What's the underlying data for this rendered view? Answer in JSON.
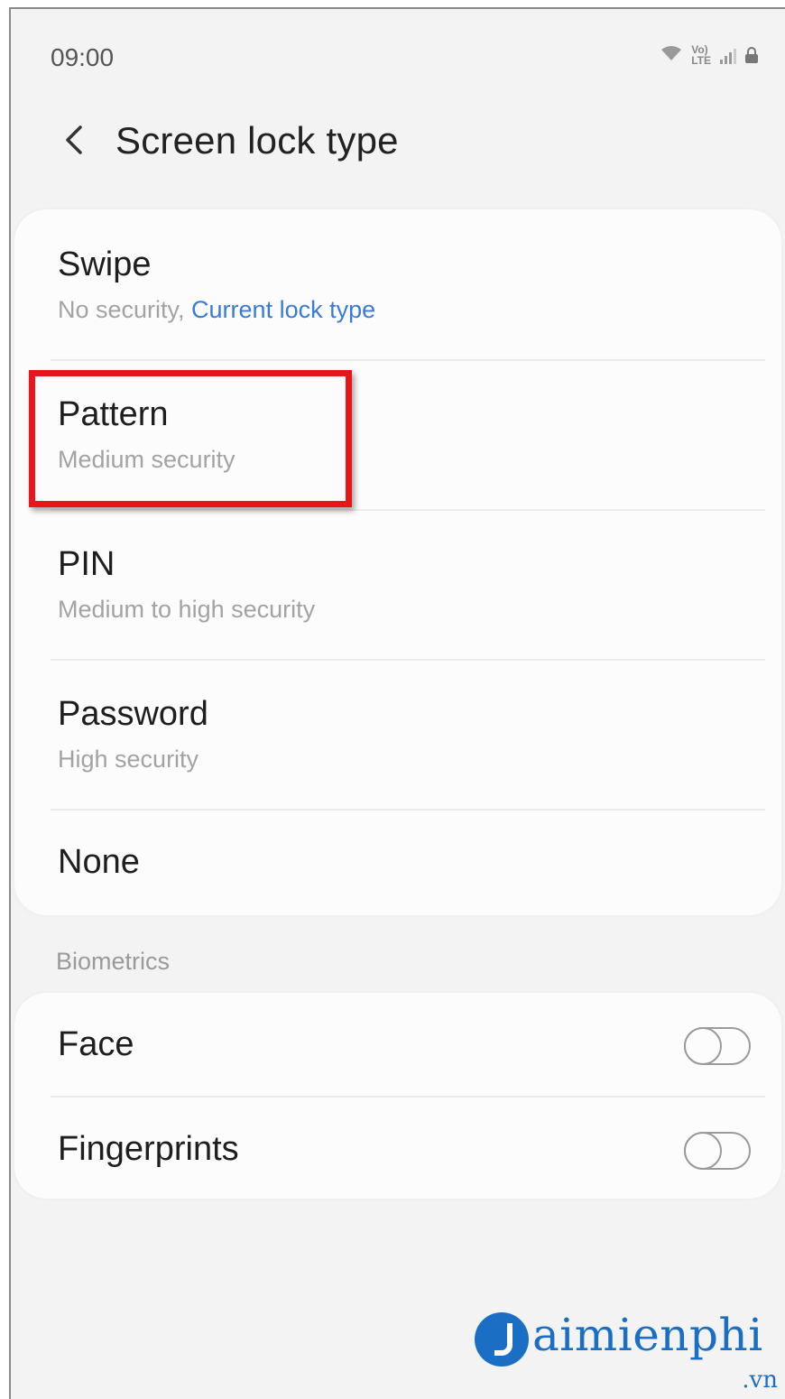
{
  "status_bar": {
    "time": "09:00",
    "icons": [
      "wifi-icon",
      "volte-icon",
      "signal-icon",
      "lock-icon"
    ],
    "volte_label": "VoLTE"
  },
  "header": {
    "title": "Screen lock type",
    "back_icon": "chevron-left-icon"
  },
  "lock_types": [
    {
      "title": "Swipe",
      "subtitle": "No security, ",
      "subtitle_accent": "Current lock type"
    },
    {
      "title": "Pattern",
      "subtitle": "Medium security"
    },
    {
      "title": "PIN",
      "subtitle": "Medium to high security"
    },
    {
      "title": "Password",
      "subtitle": "High security"
    },
    {
      "title": "None"
    }
  ],
  "biometrics": {
    "section_label": "Biometrics",
    "items": [
      {
        "title": "Face",
        "enabled": false
      },
      {
        "title": "Fingerprints",
        "enabled": false
      }
    ]
  },
  "highlight": {
    "target": "Pattern",
    "color": "#e8161b"
  },
  "watermark": {
    "brand": "aimienphi",
    "tld": ".vn",
    "color": "#1a6fc4"
  },
  "colors": {
    "accent": "#3a7bd5",
    "background": "#f3f3f3",
    "card": "#fcfcfc"
  }
}
